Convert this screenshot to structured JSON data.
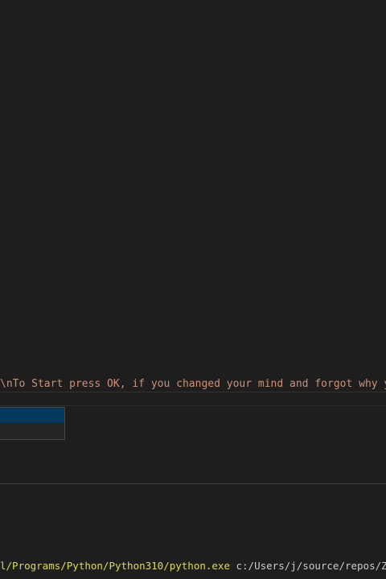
{
  "editor": {
    "code_line_text": "\\nTo Start press OK, if you changed your mind and forgot why you"
  },
  "suggest": {
    "items": [
      "",
      ""
    ],
    "selected_index": 0
  },
  "terminal": {
    "executable": "l/Programs/Python/Python310/python.exe",
    "argument": " c:/Users/j/source/repos/ZTypeA"
  },
  "colors": {
    "background": "#1e1e1e",
    "string": "#ce9178",
    "selection": "#04395e",
    "terminal_exe": "#dcdc55",
    "terminal_text": "#cccccc"
  }
}
